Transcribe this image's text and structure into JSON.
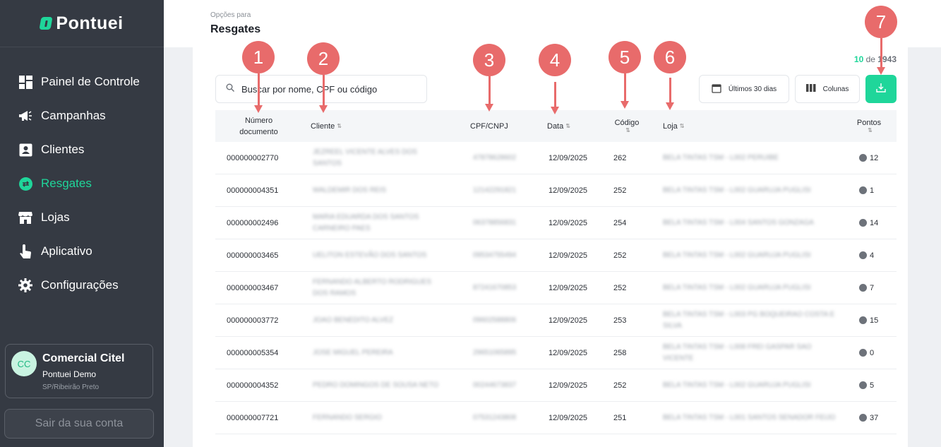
{
  "app": {
    "logo_text": "Pontuei"
  },
  "sidebar": {
    "items": [
      {
        "label": "Painel de Controle",
        "icon": "dashboard-icon"
      },
      {
        "label": "Campanhas",
        "icon": "megaphone-icon"
      },
      {
        "label": "Clientes",
        "icon": "contact-card-icon"
      },
      {
        "label": "Resgates",
        "icon": "exchange-icon",
        "active": true
      },
      {
        "label": "Lojas",
        "icon": "store-icon"
      },
      {
        "label": "Aplicativo",
        "icon": "touch-icon"
      },
      {
        "label": "Configurações",
        "icon": "gear-icon"
      }
    ],
    "user": {
      "initials": "CC",
      "name": "Comercial Citel",
      "org": "Pontuei Demo",
      "location": "SP/Ribeirão Preto"
    },
    "logout_label": "Sair da sua conta"
  },
  "header": {
    "subtitle": "Opções para",
    "title": "Resgates"
  },
  "toolbar": {
    "count_current": "10",
    "count_of": "de",
    "count_total": "1943",
    "search_placeholder": "Buscar por nome, CPF ou código",
    "date_filter": "Últimos 30 dias",
    "columns_label": "Colunas"
  },
  "table": {
    "columns": [
      "Número documento",
      "Cliente",
      "CPF/CNPJ",
      "Data",
      "Código",
      "Loja",
      "Pontos"
    ],
    "rows": [
      {
        "doc": "000000002770",
        "client": "JEZREEL VICENTE ALVES DOS SANTOS",
        "cpf": "47878628602",
        "date": "12/09/2025",
        "code": "262",
        "store": "BELA TINTAS TSM - L002 PERUIBE",
        "points": "12"
      },
      {
        "doc": "000000004351",
        "client": "WALDEMIR DOS REIS",
        "cpf": "12142291821",
        "date": "12/09/2025",
        "code": "252",
        "store": "BELA TINTAS TSM - L002 GUARUJA PUGLISI",
        "points": "1"
      },
      {
        "doc": "000000002496",
        "client": "MARIA EDUARDA DOS SANTOS CARNEIRO PAES",
        "cpf": "06378856831",
        "date": "12/09/2025",
        "code": "254",
        "store": "BELA TINTAS TSM - L004 SANTOS GONZAGA",
        "points": "14"
      },
      {
        "doc": "000000003465",
        "client": "UELITON ESTEVÃO DOS SANTOS",
        "cpf": "09534755494",
        "date": "12/09/2025",
        "code": "252",
        "store": "BELA TINTAS TSM - L002 GUARUJA PUGLISI",
        "points": "4"
      },
      {
        "doc": "000000003467",
        "client": "FERNANDO ALBERTO RODRIGUES DOS RAMOS",
        "cpf": "87241670853",
        "date": "12/09/2025",
        "code": "252",
        "store": "BELA TINTAS TSM - L002 GUARUJA PUGLISI",
        "points": "7"
      },
      {
        "doc": "000000003772",
        "client": "JOAO BENEDITO ALVEZ",
        "cpf": "09602588806",
        "date": "12/09/2025",
        "code": "253",
        "store": "BELA TINTAS TSM - L003 PG BOQUEIRAO COSTA E SILVA",
        "points": "15"
      },
      {
        "doc": "000000005354",
        "client": "JOSE MIGUEL PEREIRA",
        "cpf": "29651065895",
        "date": "12/09/2025",
        "code": "258",
        "store": "BELA TINTAS TSM - L008 FREI GASPAR SAO VICENTE",
        "points": "0"
      },
      {
        "doc": "000000004352",
        "client": "PEDRO DOMINGOS DE SOUSA NETO",
        "cpf": "00244673837",
        "date": "12/09/2025",
        "code": "252",
        "store": "BELA TINTAS TSM - L002 GUARUJA PUGLISI",
        "points": "5"
      },
      {
        "doc": "000000007721",
        "client": "FERNANDO SERGIO",
        "cpf": "07531243808",
        "date": "12/09/2025",
        "code": "251",
        "store": "BELA TINTAS TSM - L001 SANTOS SENADOR FEIJO",
        "points": "37"
      }
    ]
  },
  "annotations": [
    "1",
    "2",
    "3",
    "4",
    "5",
    "6",
    "7"
  ],
  "colors": {
    "sidebar": "#353a43",
    "accent": "#1fd69a",
    "marker": "#e86b6b"
  }
}
